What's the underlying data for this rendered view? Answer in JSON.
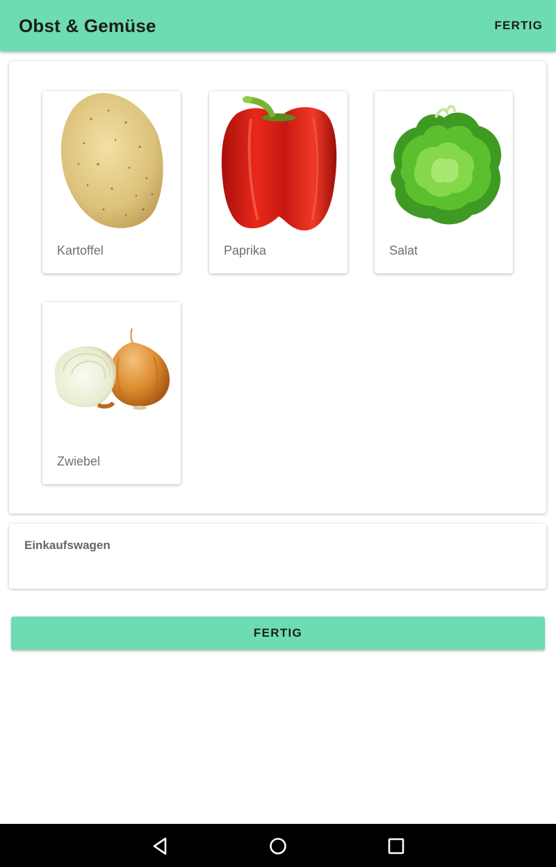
{
  "appbar": {
    "title": "Obst & Gemüse",
    "action_label": "FERTIG",
    "color": "#6edcb3"
  },
  "products": [
    {
      "label": "Kartoffel",
      "icon": "potato-image"
    },
    {
      "label": "Paprika",
      "icon": "red-bell-pepper-image"
    },
    {
      "label": "Salat",
      "icon": "lettuce-image"
    },
    {
      "label": "Zwiebel",
      "icon": "onion-image"
    }
  ],
  "cart": {
    "title": "Einkaufswagen"
  },
  "done_button": {
    "label": "FERTIG"
  },
  "navbar": {
    "buttons": [
      "back-icon",
      "home-icon",
      "recents-icon"
    ]
  }
}
